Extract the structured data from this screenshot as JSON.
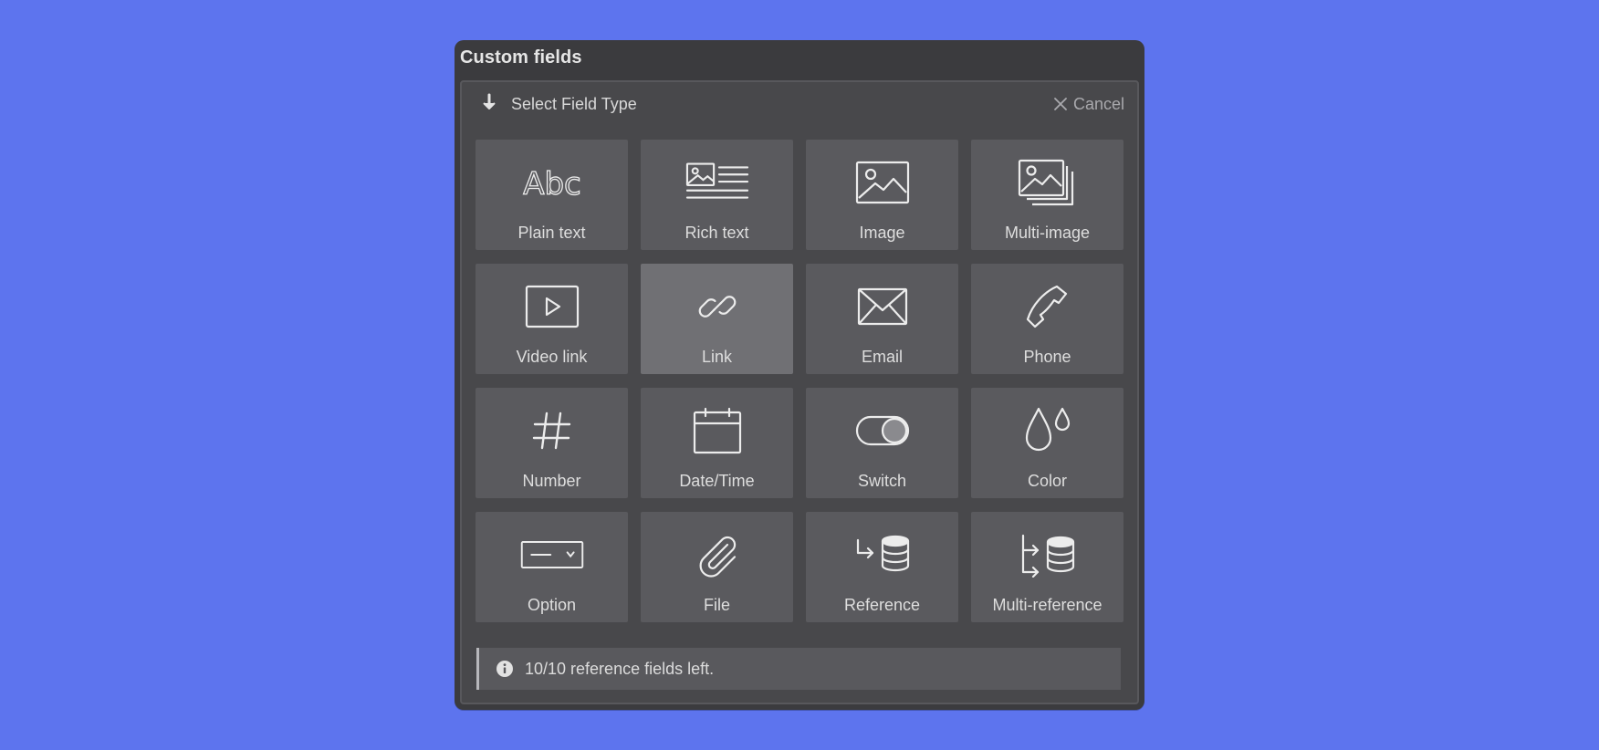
{
  "panel": {
    "title": "Custom fields"
  },
  "header": {
    "title": "Select Field Type",
    "cancel_label": "Cancel",
    "icon": "arrow-down-icon"
  },
  "field_types": [
    {
      "label": "Plain text",
      "icon": "text-abc-icon",
      "selected": false
    },
    {
      "label": "Rich text",
      "icon": "rich-text-icon",
      "selected": false
    },
    {
      "label": "Image",
      "icon": "image-icon",
      "selected": false
    },
    {
      "label": "Multi-image",
      "icon": "multi-image-icon",
      "selected": false
    },
    {
      "label": "Video link",
      "icon": "video-play-icon",
      "selected": false
    },
    {
      "label": "Link",
      "icon": "link-icon",
      "selected": true
    },
    {
      "label": "Email",
      "icon": "envelope-icon",
      "selected": false
    },
    {
      "label": "Phone",
      "icon": "phone-icon",
      "selected": false
    },
    {
      "label": "Number",
      "icon": "hash-icon",
      "selected": false
    },
    {
      "label": "Date/Time",
      "icon": "calendar-icon",
      "selected": false
    },
    {
      "label": "Switch",
      "icon": "toggle-icon",
      "selected": false
    },
    {
      "label": "Color",
      "icon": "droplets-icon",
      "selected": false
    },
    {
      "label": "Option",
      "icon": "dropdown-select-icon",
      "selected": false
    },
    {
      "label": "File",
      "icon": "paperclip-icon",
      "selected": false
    },
    {
      "label": "Reference",
      "icon": "reference-database-icon",
      "selected": false
    },
    {
      "label": "Multi-reference",
      "icon": "multi-reference-database-icon",
      "selected": false
    }
  ],
  "info": {
    "icon": "info-circle-icon",
    "text": "10/10 reference fields left."
  },
  "colors": {
    "background": "#5d74ee",
    "panel": "#3b3b3e",
    "tile": "#5a5a5e",
    "tile_selected": "#707074"
  }
}
